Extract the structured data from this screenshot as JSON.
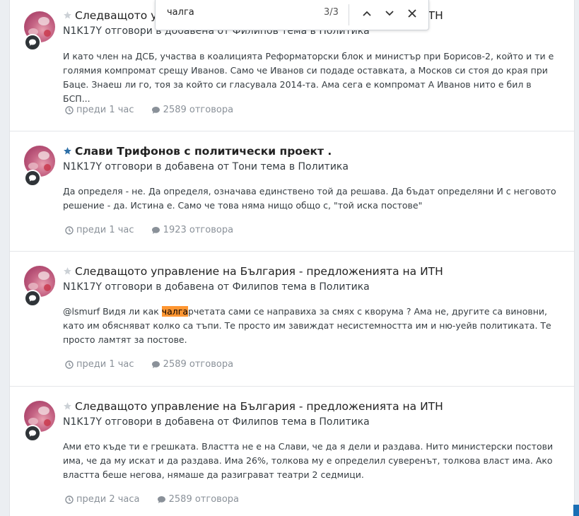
{
  "find_bar": {
    "query": "чалга",
    "count": "3/3"
  },
  "items": [
    {
      "title": "Следващото управление на България - предложенията на ИТН",
      "title_bold": false,
      "starred": false,
      "meta": "N1K17Y отговори в добавена от Филипов тема в Политика",
      "body": "И като член на ДСБ, участва в коалицията Реформаторски блок и министър при Борисов-2, който и ти е голямия компромат срещу Иванов. Само че Иванов си подаде оставката, а Москов си стоя до края при Баце. Знаеш ли го, тоя за който си гласувала 2014-та. Ама сега е компромат А Иванов нито е бил в БСП...",
      "time": "преди 1 час",
      "replies": "2589 отговора"
    },
    {
      "title": "Слави Трифонов с политически проект .",
      "title_bold": true,
      "starred": true,
      "meta": "N1K17Y отговори в добавена от Тони тема в Политика",
      "body": "Да определя - не. Да определя, означава единствено той да решава. Да бъдат определяни И с неговото решение - да. Истина е. Само че това няма нищо общо с, \"той иска постове\"",
      "time": "преди 1 час",
      "replies": "1923 отговора"
    },
    {
      "title": "Следващото управление на България - предложенията на ИТН",
      "title_bold": false,
      "starred": false,
      "meta": "N1K17Y отговори в добавена от Филипов тема в Политика",
      "body_pre": "@lsmurf Видя ли как ",
      "body_hl": "чалга",
      "body_post": "рчетата сами се направиха за смях с кворума ? Ама не, другите са виновни, като им обясняват колко са тъпи. Те просто им завиждат несистемността им и ню-уейв политиката. Те просто ламтят за постове.",
      "time": "преди 1 час",
      "replies": "2589 отговора"
    },
    {
      "title": "Следващото управление на България - предложенията на ИТН",
      "title_bold": false,
      "starred": false,
      "meta": "N1K17Y отговори в добавена от Филипов тема в Политика",
      "body": "Ами ето къде ти е грешката. Властта не е на Слави, че да я дели и раздава. Нито министерски постови има, че да му искат и да раздава. Има 26%, толкова му е определил суверенът, толкова власт има. Ако властта беше негова, нямаше да разиграват театри 2 седмици.",
      "time": "преди 2 часа",
      "replies": "2589 отговора"
    }
  ]
}
